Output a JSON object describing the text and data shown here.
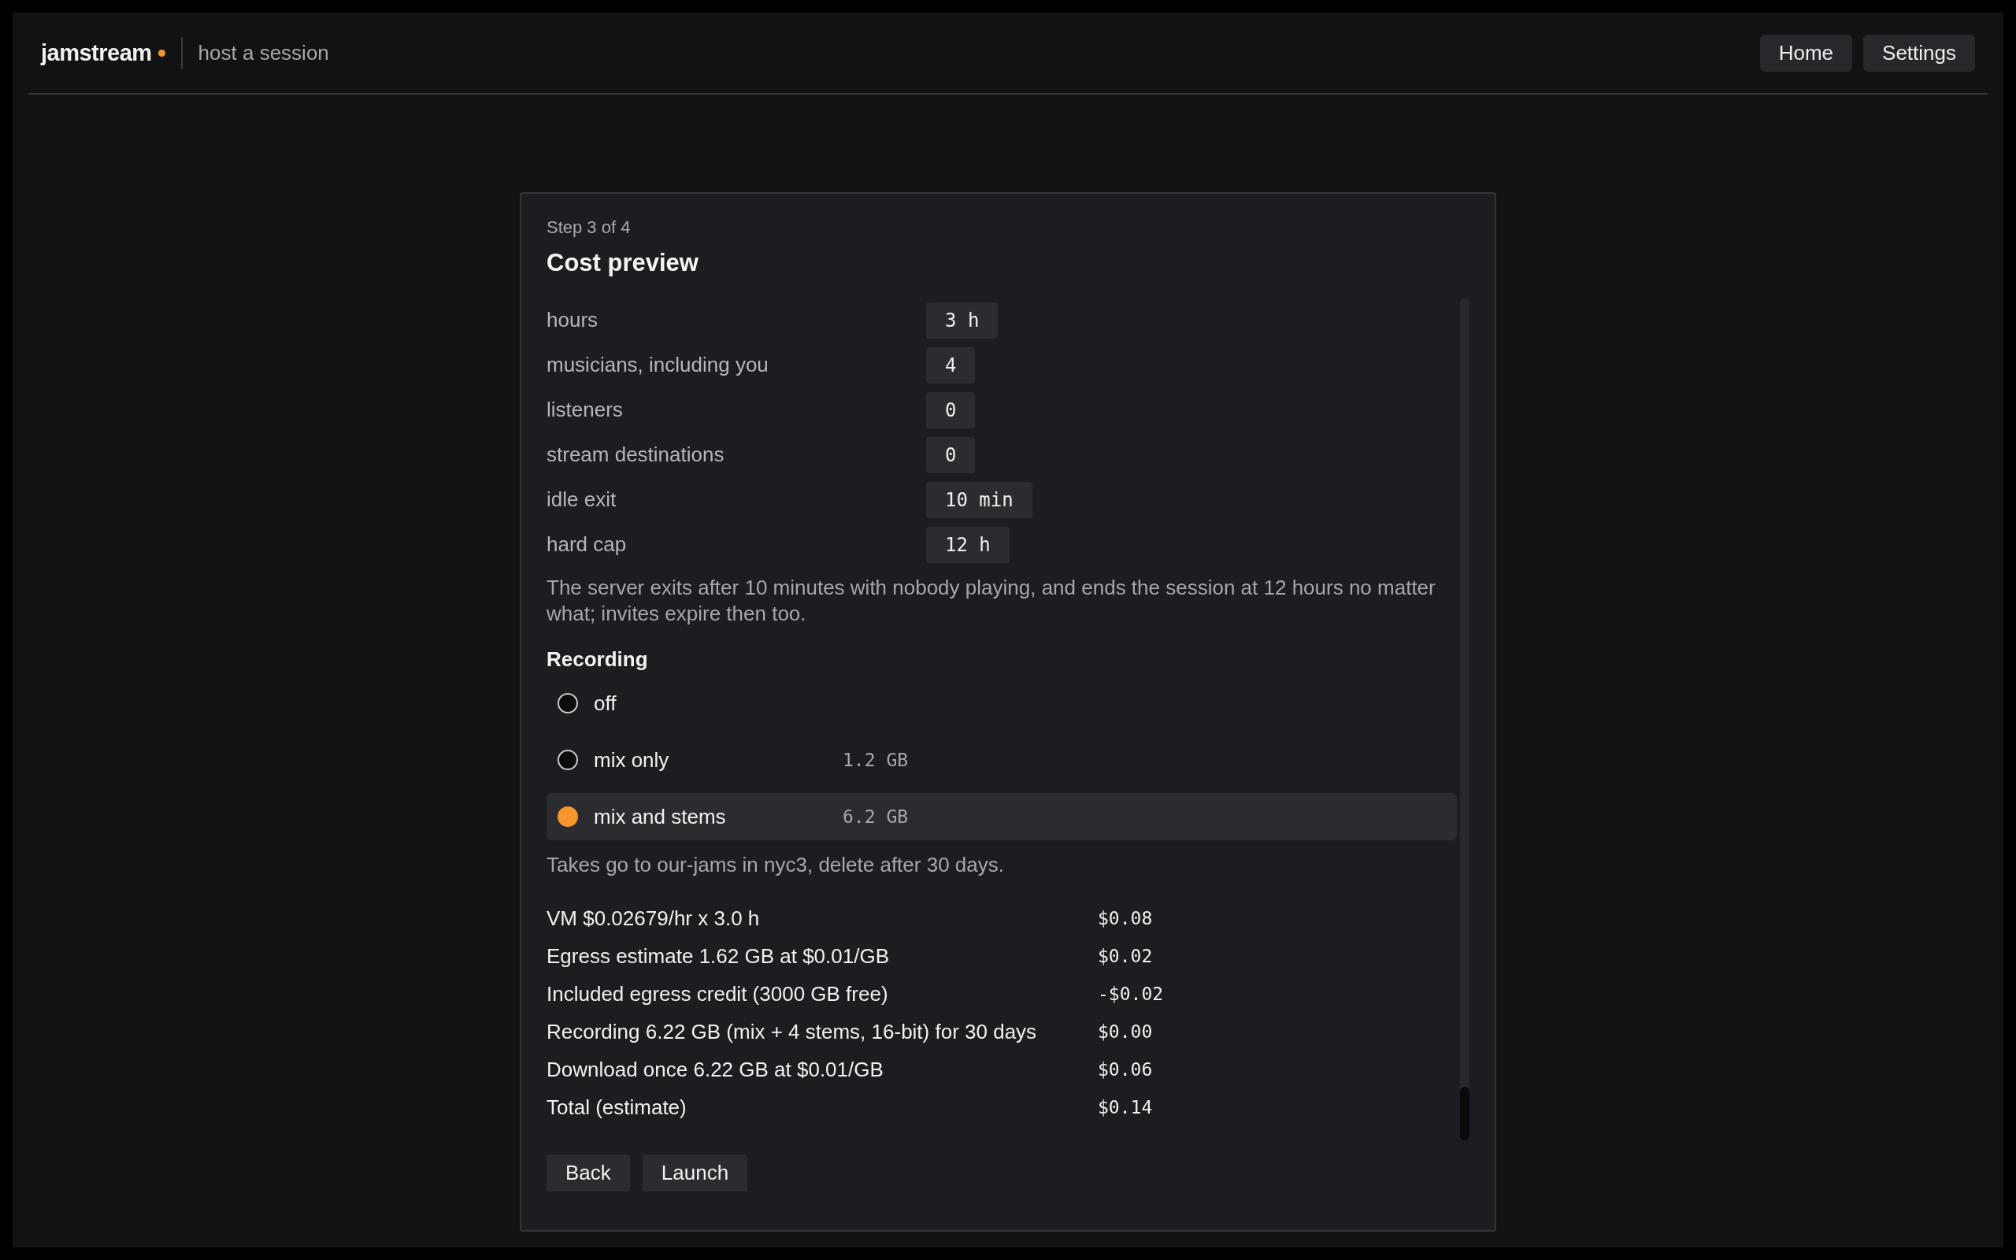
{
  "header": {
    "brand": "jamstream",
    "subtitle": "host a session",
    "nav": [
      "Home",
      "Settings"
    ]
  },
  "card": {
    "step": "Step 3 of 4",
    "title": "Cost preview",
    "fields": [
      {
        "label": "hours",
        "value": "3 h"
      },
      {
        "label": "musicians, including you",
        "value": "4"
      },
      {
        "label": "listeners",
        "value": "0"
      },
      {
        "label": "stream destinations",
        "value": "0"
      },
      {
        "label": "idle exit",
        "value": "10 min"
      },
      {
        "label": "hard cap",
        "value": "12 h"
      }
    ],
    "note": "The server exits after 10 minutes with nobody playing, and ends the session at 12 hours no matter what; invites expire then too.",
    "recording": {
      "title": "Recording",
      "options": [
        {
          "label": "off",
          "selected": false
        },
        {
          "label": "mix only",
          "size": "1.2 GB",
          "selected": false
        },
        {
          "label": "mix and stems",
          "size": "6.2 GB",
          "selected": true
        }
      ],
      "note": "Takes go to our-jams in nyc3, delete after 30 days."
    },
    "costs": [
      {
        "label": "VM $0.02679/hr x 3.0 h",
        "amount": "$0.08"
      },
      {
        "label": "Egress estimate 1.62 GB at $0.01/GB",
        "amount": "$0.02"
      },
      {
        "label": "Included egress credit (3000 GB free)",
        "amount": "-$0.02"
      },
      {
        "label": "Recording 6.22 GB (mix + 4 stems, 16-bit) for 30 days",
        "amount": "$0.00"
      },
      {
        "label": "Download once 6.22 GB at $0.01/GB",
        "amount": "$0.06"
      },
      {
        "label": "Total (estimate)",
        "amount": "$0.14"
      }
    ],
    "buttons": [
      "Back",
      "Launch"
    ]
  }
}
